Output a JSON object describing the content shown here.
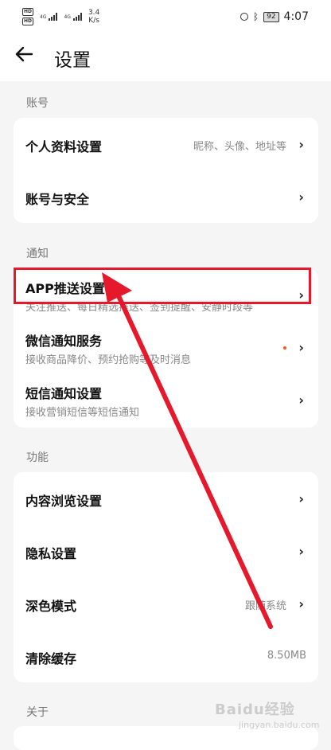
{
  "status_bar": {
    "network_tag1": "HD",
    "network_tag2": "HD",
    "signal_tag": "4G",
    "signal_tag2": "4G",
    "speed": "3.4",
    "speed_unit": "K/s",
    "battery": "92",
    "time": "4:07"
  },
  "header": {
    "title": "设置"
  },
  "sections": {
    "account": {
      "label": "账号",
      "items": [
        {
          "title": "个人资料设置",
          "value": "昵称、头像、地址等"
        },
        {
          "title": "账号与安全"
        }
      ]
    },
    "notify": {
      "label": "通知",
      "items": [
        {
          "title": "APP推送设置",
          "subtitle": "关注推送、每日精选推送、签到提醒、安静时段等"
        },
        {
          "title": "微信通知服务",
          "subtitle": "接收商品降价、预约抢购等及时消息"
        },
        {
          "title": "短信通知设置",
          "subtitle": "接收营销短信等短信通知"
        }
      ]
    },
    "features": {
      "label": "功能",
      "items": [
        {
          "title": "内容浏览设置"
        },
        {
          "title": "隐私设置"
        },
        {
          "title": "深色模式",
          "value": "跟随系统"
        },
        {
          "title": "清除缓存",
          "value": "8.50MB"
        }
      ]
    },
    "about": {
      "label": "关于"
    }
  },
  "watermark": {
    "text": "Baidu经验",
    "sub": "jingyan.baidu.com"
  },
  "colors": {
    "annotation": "#e5192b",
    "badge_dot": "#ff5722"
  }
}
